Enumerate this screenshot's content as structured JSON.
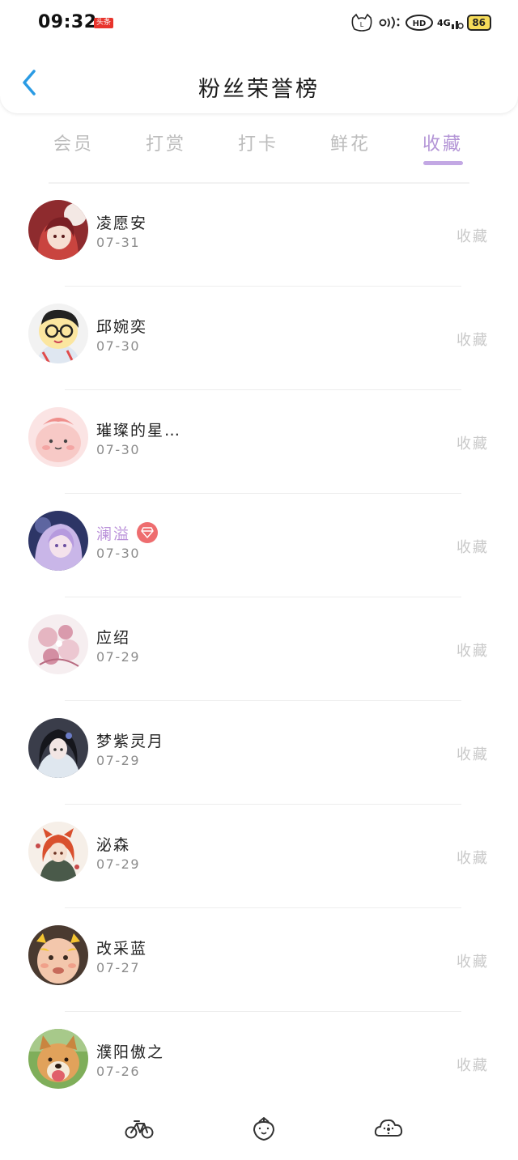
{
  "status_bar": {
    "time": "09:32",
    "badge": "头条",
    "network": "4G",
    "hd": "HD",
    "battery": "86"
  },
  "header": {
    "title": "粉丝荣誉榜",
    "back_icon": "chevron-left-icon",
    "back_color": "#2a9be4"
  },
  "tabs": [
    {
      "label": "会员",
      "active": false
    },
    {
      "label": "打赏",
      "active": false
    },
    {
      "label": "打卡",
      "active": false
    },
    {
      "label": "鲜花",
      "active": false
    },
    {
      "label": "收藏",
      "active": true
    }
  ],
  "colors": {
    "accent": "#b394d6",
    "vip_name": "#b98fd9",
    "vip_badge": "#ee6d6f",
    "muted": "#c9c9c9"
  },
  "fans": [
    {
      "name": "凌愿安",
      "date": "07-31",
      "action": "收藏",
      "vip": false
    },
    {
      "name": "邱婉奕",
      "date": "07-30",
      "action": "收藏",
      "vip": false
    },
    {
      "name": "璀璨的星…",
      "date": "07-30",
      "action": "收藏",
      "vip": false
    },
    {
      "name": "澜溢",
      "date": "07-30",
      "action": "收藏",
      "vip": true
    },
    {
      "name": "应绍",
      "date": "07-29",
      "action": "收藏",
      "vip": false
    },
    {
      "name": "梦紫灵月",
      "date": "07-29",
      "action": "收藏",
      "vip": false
    },
    {
      "name": "泌森",
      "date": "07-29",
      "action": "收藏",
      "vip": false
    },
    {
      "name": "改采蓝",
      "date": "07-27",
      "action": "收藏",
      "vip": false
    },
    {
      "name": "濮阳傲之",
      "date": "07-26",
      "action": "收藏",
      "vip": false
    }
  ],
  "bottom_nav": [
    {
      "icon": "bicycle-icon"
    },
    {
      "icon": "strawberry-icon"
    },
    {
      "icon": "cloud-flower-icon"
    }
  ]
}
